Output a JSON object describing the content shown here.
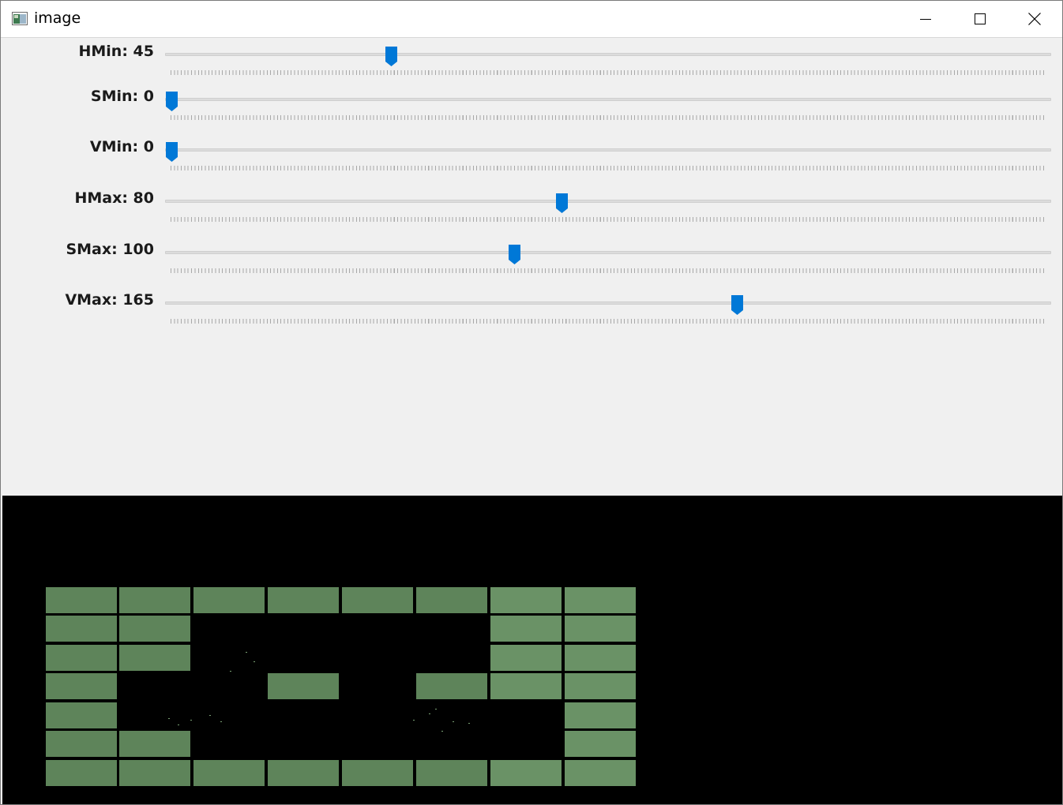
{
  "window": {
    "title": "image"
  },
  "trackbars": [
    {
      "label": "HMin: 45",
      "name": "HMin",
      "value": 45,
      "max": 179
    },
    {
      "label": "SMin: 0",
      "name": "SMin",
      "value": 0,
      "max": 255
    },
    {
      "label": "VMin: 0",
      "name": "VMin",
      "value": 0,
      "max": 255
    },
    {
      "label": "HMax: 80",
      "name": "HMax",
      "value": 80,
      "max": 179
    },
    {
      "label": "SMax: 100",
      "name": "SMax",
      "value": 100,
      "max": 255
    },
    {
      "label": "VMax: 165",
      "name": "VMax",
      "value": 165,
      "max": 255
    }
  ],
  "colors": {
    "thumb": "#0078d7",
    "brick": "#5e845a",
    "brick_light": "#6a9266",
    "mask_background": "#000000"
  },
  "icons": {
    "app": "app-image-icon",
    "minimize": "minimize-icon",
    "maximize": "maximize-icon",
    "close": "close-icon"
  }
}
